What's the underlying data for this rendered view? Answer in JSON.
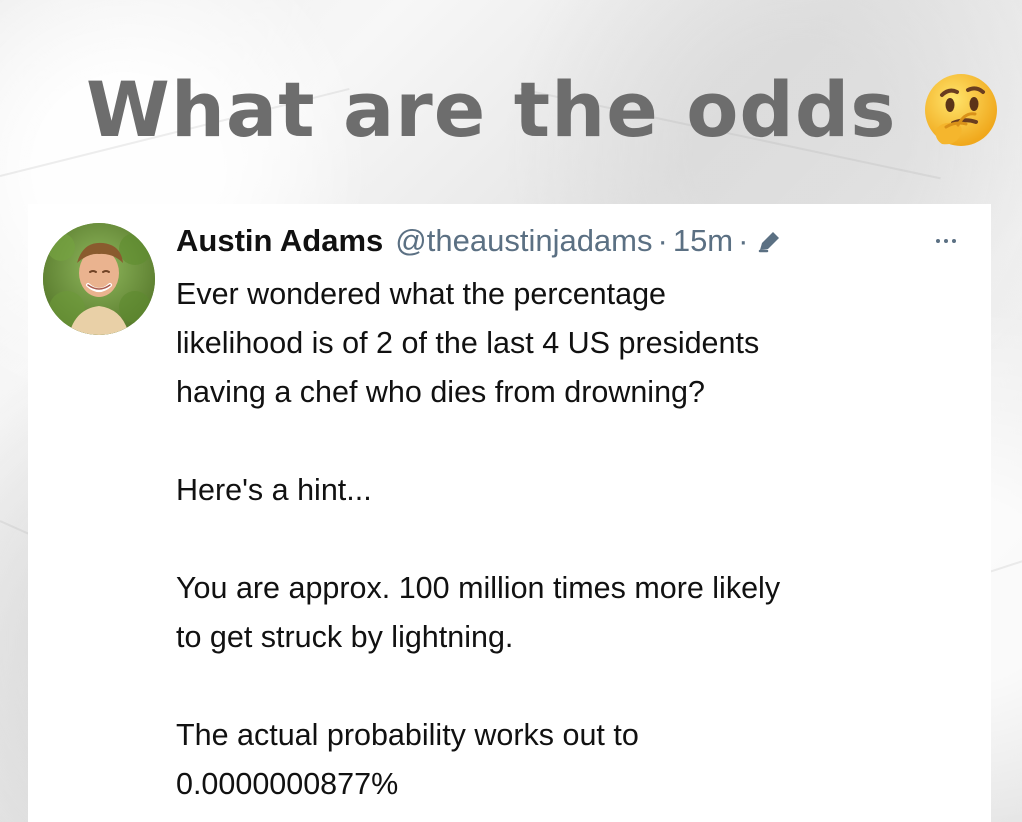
{
  "headline": {
    "text": "What are the odds",
    "emoji": "thinking-face-icon"
  },
  "tweet": {
    "author_name": "Austin Adams",
    "handle": "@theaustinjadams",
    "separator_1": "·",
    "time": "15m",
    "separator_2": "·",
    "edit_icon": "edit-icon",
    "more_icon": "more-options-icon",
    "body": {
      "p1": {
        "line1": "Ever wondered what the percentage",
        "line2": "likelihood is of 2 of the last 4 US presidents",
        "line3": "having a chef who dies from drowning?"
      },
      "p2": {
        "line1": "Here's a hint..."
      },
      "p3": {
        "line1": "You are approx. 100 million times more likely",
        "line2": "to get struck by lightning."
      },
      "p4": {
        "line1": "The actual probability works out to",
        "line2": "0.0000000877%"
      }
    }
  },
  "colors": {
    "headline": "#6d6d6d",
    "meta": "#5b7083",
    "card": "#ffffff",
    "text": "#111111"
  }
}
